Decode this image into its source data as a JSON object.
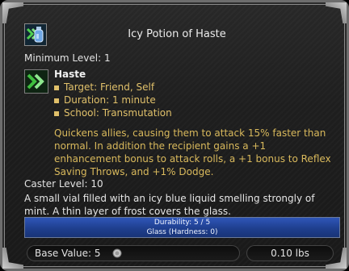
{
  "item": {
    "title": "Icy Potion of Haste",
    "icon": "potion-bottle-icon",
    "min_level_text": "Minimum Level: 1"
  },
  "effect": {
    "icon": "haste-chevrons-icon",
    "name": "Haste",
    "properties": [
      "Target: Friend, Self",
      "Duration: 1 minute",
      "School: Transmutation"
    ],
    "description": "Quickens allies, causing them to attack 15% faster than normal. In addition the recipient gains a +1 enhancement bonus to attack rolls, a +1 bonus to Reflex Saving Throws, and +1% Dodge."
  },
  "caster_level_text": "Caster Level: 10",
  "flavor_text": "A small vial filled with an icy blue liquid smelling strongly of mint. A thin layer of frost covers the glass.",
  "durability": {
    "line1": "Durability: 5 / 5",
    "line2": "Glass (Hardness: 0)"
  },
  "footer": {
    "base_value_text": "Base Value: 5",
    "coin_icon": "silver-coin-icon",
    "weight_text": "0.10 lbs"
  },
  "colors": {
    "effect_text": "#e0c06a",
    "durability_bar": "#2f56b8",
    "background": "#1f1f1f"
  }
}
